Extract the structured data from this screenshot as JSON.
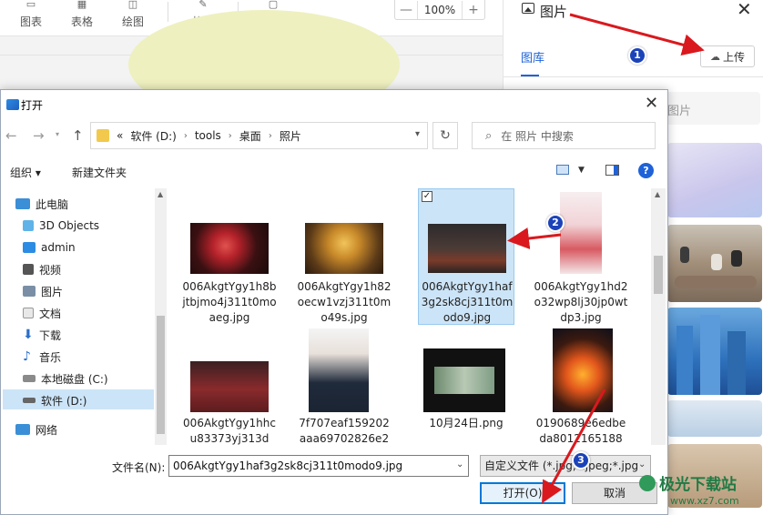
{
  "toolbar": {
    "items": [
      {
        "label": "图表",
        "icon": "chart-icon"
      },
      {
        "label": "表格",
        "icon": "table-icon"
      },
      {
        "label": "绘图",
        "icon": "draw-icon"
      },
      {
        "label": "格式",
        "icon": "format-brush-icon"
      },
      {
        "label": "评论",
        "icon": "comment-icon"
      }
    ],
    "zoom": {
      "minus": "—",
      "value": "100%",
      "plus": "+"
    }
  },
  "panel": {
    "title": "图片",
    "close": "✕",
    "tab_library": "图库",
    "upload_label": "上传",
    "search_placeholder": "图片"
  },
  "dialog": {
    "title": "打开",
    "close": "✕",
    "breadcrumbs": [
      "«",
      "软件 (D:)",
      "›",
      "tools",
      "›",
      "桌面",
      "›",
      "照片"
    ],
    "search_placeholder": "在 照片 中搜索",
    "organize_label": "组织 ▾",
    "new_folder_label": "新建文件夹",
    "help": "?",
    "tree": [
      {
        "label": "此电脑",
        "icon": "computer-icon"
      },
      {
        "label": "3D Objects",
        "icon": "3d-objects-icon"
      },
      {
        "label": "admin",
        "icon": "user-folder-icon"
      },
      {
        "label": "视频",
        "icon": "video-icon"
      },
      {
        "label": "图片",
        "icon": "pictures-icon"
      },
      {
        "label": "文档",
        "icon": "documents-icon"
      },
      {
        "label": "下载",
        "icon": "download-icon"
      },
      {
        "label": "音乐",
        "icon": "music-icon"
      },
      {
        "label": "本地磁盘 (C:)",
        "icon": "drive-icon"
      },
      {
        "label": "软件 (D:)",
        "icon": "drive-icon"
      },
      {
        "label": "网络",
        "icon": "network-icon"
      }
    ],
    "files": [
      {
        "name": "006AkgtYgy1h8bjtbjmo4j311t0moaeg.jpg"
      },
      {
        "name": "006AkgtYgy1h82oecw1vzj311t0mo49s.jpg"
      },
      {
        "name": "006AkgtYgy1haf3g2sk8cj311t0modo9.jpg"
      },
      {
        "name": "006AkgtYgy1hd2o32wp8lj30jp0wtdp3.jpg"
      },
      {
        "name": "006AkgtYgy1hhcu83373yj313d"
      },
      {
        "name": "7f707eaf159202aaa69702826e2"
      },
      {
        "name": "10月24日.png"
      },
      {
        "name": "0190689e6edbeda8012165188"
      }
    ],
    "filename_label": "文件名(N):",
    "filename_value": "006AkgtYgy1haf3g2sk8cj311t0modo9.jpg",
    "filetype_value": "自定义文件 (*.jpg;*.jpeg;*.jpg",
    "open_label": "打开(O)",
    "cancel_label": "取消"
  },
  "markers": [
    "1",
    "2",
    "3"
  ],
  "watermark": {
    "text": "极光下载站",
    "url": "www.xz7.com"
  },
  "colors": {
    "accent": "#1f62d8",
    "marker": "#1b43b9",
    "arrow": "#d9191e",
    "selection": "#cce4f7"
  }
}
